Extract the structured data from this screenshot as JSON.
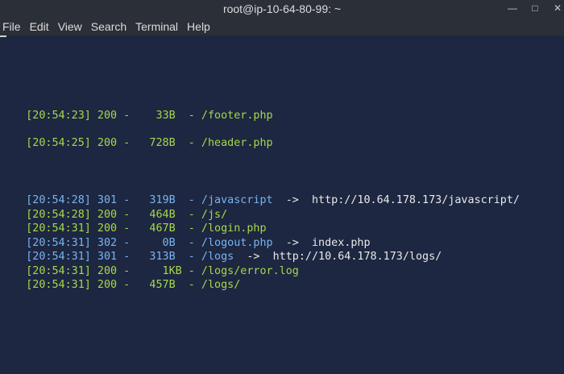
{
  "window": {
    "title": "root@ip-10-64-80-99: ~",
    "buttons": [
      "minimize",
      "maximize",
      "close"
    ]
  },
  "menu": [
    "File",
    "Edit",
    "View",
    "Search",
    "Terminal",
    "Help"
  ],
  "colors": {
    "background": "#1d2741",
    "status_200": "#a6d84a",
    "status_3xx": "#79b4f0",
    "plain": "#e9e9e9"
  },
  "lines": [
    {
      "prefix": "[20:54:23] 200 -    33B  - /footer.php",
      "arrow": "",
      "target": "",
      "status": "200"
    },
    {
      "prefix": "[20:54:25] 200 -   728B  - /header.php",
      "arrow": "",
      "target": "",
      "status": "200"
    },
    {
      "prefix": "[20:54:28] 301 -   319B  - /javascript",
      "arrow": "  ->  ",
      "target": "http://10.64.178.173/javascript/",
      "status": "301"
    },
    {
      "prefix": "[20:54:28] 200 -   464B  - /js/",
      "arrow": "",
      "target": "",
      "status": "200"
    },
    {
      "prefix": "[20:54:31] 200 -   467B  - /login.php",
      "arrow": "",
      "target": "",
      "status": "200"
    },
    {
      "prefix": "[20:54:31] 302 -     0B  - /logout.php",
      "arrow": "  ->  ",
      "target": "index.php",
      "status": "302"
    },
    {
      "prefix": "[20:54:31] 301 -   313B  - /logs",
      "arrow": "  ->  ",
      "target": "http://10.64.178.173/logs/",
      "status": "301"
    },
    {
      "prefix": "[20:54:31] 200 -     1KB - /logs/error.log",
      "arrow": "",
      "target": "",
      "status": "200"
    },
    {
      "prefix": "[20:54:31] 200 -   457B  - /logs/",
      "arrow": "",
      "target": "",
      "status": "200"
    }
  ]
}
